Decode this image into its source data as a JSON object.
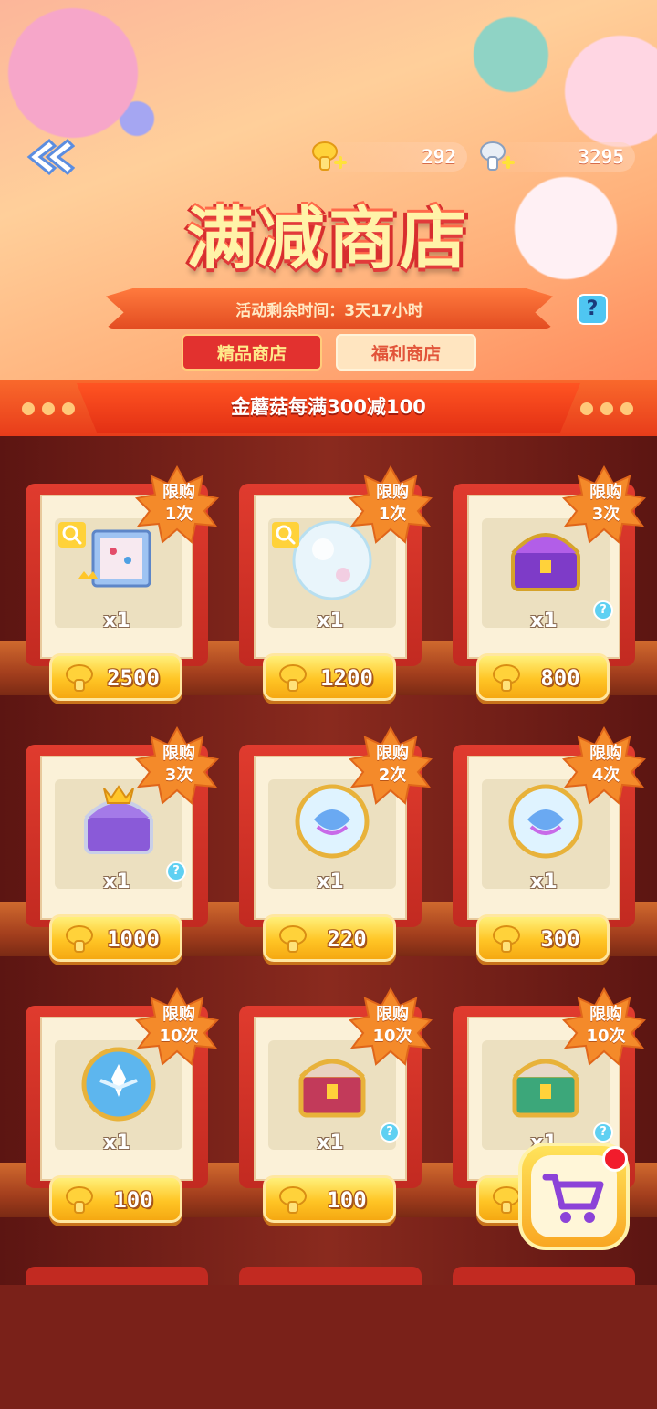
{
  "header": {
    "title": "满减商店",
    "countdown": "活动剩余时间：3天17小时",
    "help_label": "?",
    "gold_mushrooms": "292",
    "silver_mushrooms": "3295"
  },
  "tabs": [
    {
      "label": "精品商店",
      "active": true
    },
    {
      "label": "福利商店",
      "active": false
    }
  ],
  "banner": {
    "text": "金蘑菇每满300减100"
  },
  "colors": {
    "accent_red": "#e2312f",
    "gold": "#ffc525",
    "background": "#6e1c18"
  },
  "items": [
    {
      "limit_line1": "限购",
      "limit_line2": "1次",
      "qty": "x1",
      "price": "2500",
      "icon": "photo-frame-icon",
      "zoom": true,
      "help": false
    },
    {
      "limit_line1": "限购",
      "limit_line2": "1次",
      "qty": "x1",
      "price": "1200",
      "icon": "bubble-orb-icon",
      "zoom": true,
      "help": false
    },
    {
      "limit_line1": "限购",
      "limit_line2": "3次",
      "qty": "x1",
      "price": "800",
      "icon": "purple-chest-icon",
      "zoom": false,
      "help": true
    },
    {
      "limit_line1": "限购",
      "limit_line2": "3次",
      "qty": "x1",
      "price": "1000",
      "icon": "crown-chest-icon",
      "zoom": false,
      "help": true
    },
    {
      "limit_line1": "限购",
      "limit_line2": "2次",
      "qty": "x1",
      "price": "220",
      "icon": "swirl-orb-icon",
      "zoom": false,
      "help": false
    },
    {
      "limit_line1": "限购",
      "limit_line2": "4次",
      "qty": "x1",
      "price": "300",
      "icon": "swirl-orb-icon",
      "zoom": false,
      "help": false
    },
    {
      "limit_line1": "限购",
      "limit_line2": "10次",
      "qty": "x1",
      "price": "100",
      "icon": "blue-crest-orb-icon",
      "zoom": false,
      "help": false
    },
    {
      "limit_line1": "限购",
      "limit_line2": "10次",
      "qty": "x1",
      "price": "100",
      "icon": "gold-red-chest-icon",
      "zoom": false,
      "help": true
    },
    {
      "limit_line1": "限购",
      "limit_line2": "10次",
      "qty": "x1",
      "price": "",
      "icon": "gold-green-chest-icon",
      "zoom": false,
      "help": true
    }
  ]
}
